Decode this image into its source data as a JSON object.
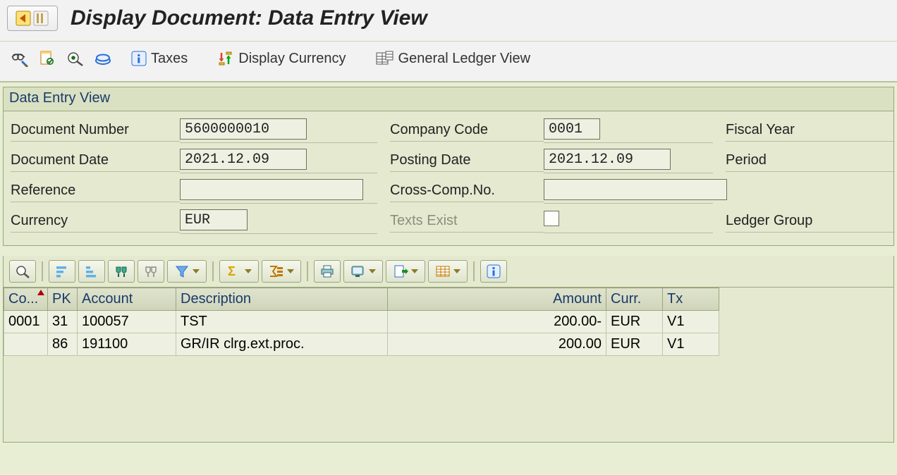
{
  "title": "Display Document: Data Entry View",
  "toolbar": {
    "taxes_label": "Taxes",
    "display_currency_label": "Display Currency",
    "gl_view_label": "General Ledger View"
  },
  "panel": {
    "title": "Data Entry View",
    "labels": {
      "doc_number": "Document Number",
      "company_code": "Company Code",
      "fiscal_year": "Fiscal Year",
      "doc_date": "Document Date",
      "posting_date": "Posting Date",
      "period": "Period",
      "reference": "Reference",
      "cross_comp_no": "Cross-Comp.No.",
      "currency": "Currency",
      "texts_exist": "Texts Exist",
      "ledger_group": "Ledger Group"
    },
    "values": {
      "doc_number": "5600000010",
      "company_code": "0001",
      "fiscal_year": "",
      "doc_date": "2021.12.09",
      "posting_date": "2021.12.09",
      "period": "",
      "reference": "",
      "cross_comp_no": "",
      "currency": "EUR",
      "texts_exist": false,
      "ledger_group": ""
    }
  },
  "grid": {
    "headers": {
      "co": "Co...",
      "pk": "PK",
      "account": "Account",
      "description": "Description",
      "amount": "Amount",
      "curr": "Curr.",
      "tx": "Tx"
    },
    "rows": [
      {
        "co": "0001",
        "pk": "31",
        "account": "100057",
        "description": "TST",
        "amount": "200.00-",
        "curr": "EUR",
        "tx": "V1"
      },
      {
        "co": "",
        "pk": "86",
        "account": "191100",
        "description": "GR/IR clrg.ext.proc.",
        "amount": "200.00",
        "curr": "EUR",
        "tx": "V1"
      }
    ]
  }
}
